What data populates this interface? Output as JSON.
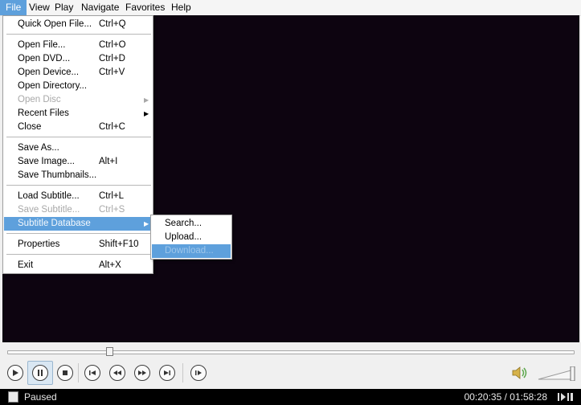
{
  "menubar": {
    "items": [
      "File",
      "View",
      "Play",
      "Navigate",
      "Favorites",
      "Help"
    ],
    "active_index": 0
  },
  "file_menu": {
    "items": [
      {
        "label": "Quick Open File...",
        "shortcut": "Ctrl+Q",
        "enabled": true
      },
      {
        "label": "Open File...",
        "shortcut": "Ctrl+O",
        "enabled": true
      },
      {
        "label": "Open DVD...",
        "shortcut": "Ctrl+D",
        "enabled": true
      },
      {
        "label": "Open Device...",
        "shortcut": "Ctrl+V",
        "enabled": true
      },
      {
        "label": "Open Directory...",
        "shortcut": "",
        "enabled": true
      },
      {
        "label": "Open Disc",
        "shortcut": "",
        "enabled": false,
        "submenu": true
      },
      {
        "label": "Recent Files",
        "shortcut": "",
        "enabled": true,
        "submenu": true
      },
      {
        "label": "Close",
        "shortcut": "Ctrl+C",
        "enabled": true
      },
      {
        "label": "Save As...",
        "shortcut": "",
        "enabled": true
      },
      {
        "label": "Save Image...",
        "shortcut": "Alt+I",
        "enabled": true
      },
      {
        "label": "Save Thumbnails...",
        "shortcut": "",
        "enabled": true
      },
      {
        "label": "Load Subtitle...",
        "shortcut": "Ctrl+L",
        "enabled": true
      },
      {
        "label": "Save Subtitle...",
        "shortcut": "Ctrl+S",
        "enabled": false
      },
      {
        "label": "Subtitle Database",
        "shortcut": "",
        "enabled": true,
        "submenu": true,
        "highlighted": true
      },
      {
        "label": "Properties",
        "shortcut": "Shift+F10",
        "enabled": true
      },
      {
        "label": "Exit",
        "shortcut": "Alt+X",
        "enabled": true
      }
    ]
  },
  "subtitle_db_submenu": {
    "items": [
      {
        "label": "Search...",
        "enabled": true
      },
      {
        "label": "Upload...",
        "enabled": true
      },
      {
        "label": "Download...",
        "enabled": false,
        "highlighted": true
      }
    ]
  },
  "player": {
    "seek_position_fraction": 0.18,
    "volume_fraction": 0.95
  },
  "statusbar": {
    "status": "Paused",
    "time": "00:20:35 / 01:58:28"
  },
  "colors": {
    "accent": "#5ea0dc",
    "video_background": "#0d0410",
    "statusbar_background": "#000000"
  }
}
